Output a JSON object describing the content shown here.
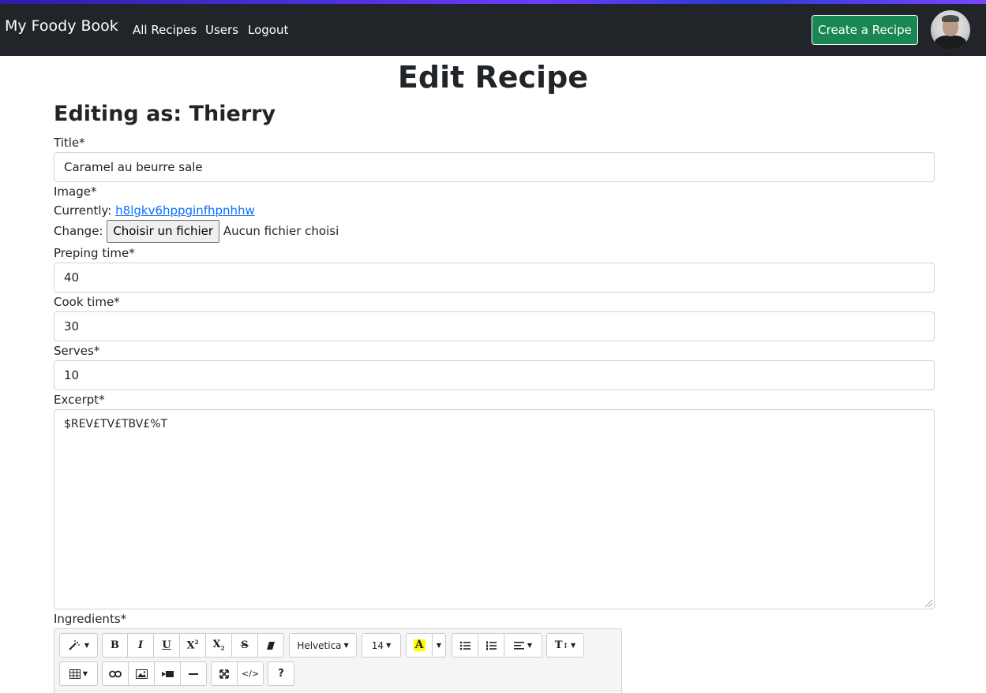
{
  "navbar": {
    "brand": "My Foody Book",
    "links": [
      "All Recipes",
      "Users",
      "Logout"
    ],
    "create_button": "Create a Recipe"
  },
  "page": {
    "title": "Edit Recipe",
    "subtitle": "Editing as: Thierry"
  },
  "form": {
    "title_label": "Title*",
    "title_value": "Caramel au beurre sale",
    "image_label": "Image*",
    "currently_label": "Currently:",
    "currently_link": "h8lgkv6hppginfhpnhhw",
    "change_label": "Change:",
    "file_button": "Choisir un fichier",
    "file_status": "Aucun fichier choisi",
    "prep_label": "Preping time*",
    "prep_value": "40",
    "cook_label": "Cook time*",
    "cook_value": "30",
    "serves_label": "Serves*",
    "serves_value": "10",
    "excerpt_label": "Excerpt*",
    "excerpt_value": "$REV£TV£TBV£%T",
    "ingredients_label": "Ingredients*"
  },
  "editor_toolbar": {
    "font_name": "Helvetica",
    "font_size": "14",
    "highlight_letter": "A",
    "bold": "B",
    "italic": "I",
    "underline": "U",
    "superscript": "X",
    "subscript": "X",
    "strikethrough": "S",
    "text_height": "T",
    "help": "?",
    "code": "</>",
    "highlight_color": "#ffff00"
  },
  "colors": {
    "navbar_bg": "#212529",
    "create_button_bg": "#198754",
    "link": "#0d6efd"
  }
}
